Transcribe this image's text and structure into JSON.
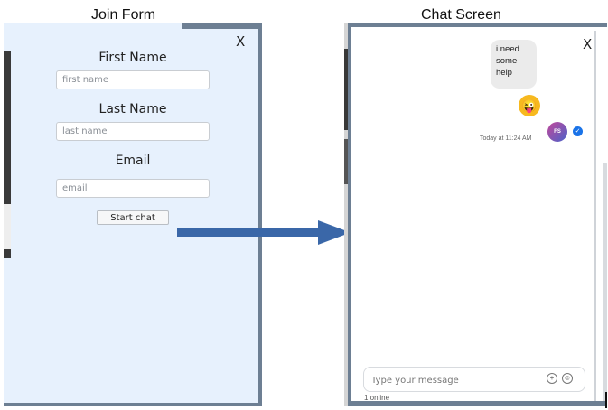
{
  "captions": {
    "join": "Join Form",
    "chat": "Chat Screen"
  },
  "join_form": {
    "close_label": "X",
    "fields": [
      {
        "label": "First Name",
        "placeholder": "first name",
        "value": ""
      },
      {
        "label": "Last Name",
        "placeholder": "last name",
        "value": ""
      },
      {
        "label": "Email",
        "placeholder": "email",
        "value": ""
      }
    ],
    "start_label": "Start chat"
  },
  "chat": {
    "close_label": "X",
    "message": {
      "lines": [
        "i need",
        "some",
        "help"
      ],
      "emoji": "😜",
      "timestamp": "Today at 11:24 AM",
      "avatar_initials": "FS",
      "status_icon": "check-icon"
    },
    "composer": {
      "placeholder": "Type your message",
      "add_icon": "plus-circle-icon",
      "emoji_icon": "smile-icon"
    },
    "online_text": "1 online"
  },
  "colors": {
    "frame": "#6d7f93",
    "join_bg": "#e7f1fd",
    "arrow": "#3a67a8",
    "bubble": "#ebebeb",
    "check": "#1a73e8"
  }
}
